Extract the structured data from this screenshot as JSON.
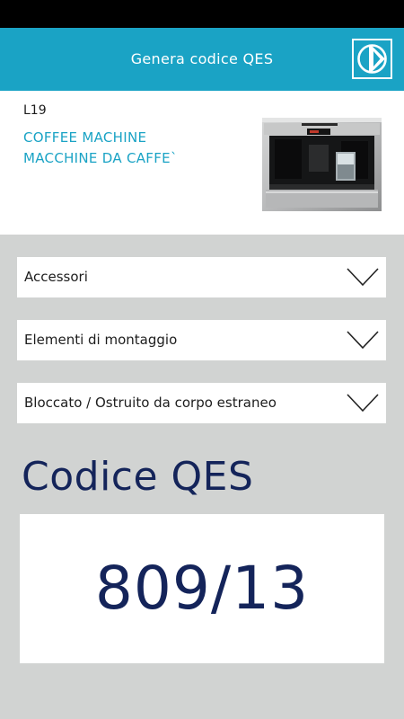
{
  "header": {
    "title": "Genera codice QES",
    "logo_icon": "electrolux-logo-icon",
    "background_color": "#1aa3c5"
  },
  "product": {
    "model": "L19",
    "type_line1": "COFFEE MACHINE",
    "type_line2": "MACCHINE DA CAFFE`",
    "image_icon": "coffee-machine-image"
  },
  "dropdowns": [
    {
      "label": "Accessori",
      "icon": "chevron-down-icon"
    },
    {
      "label": "Elementi di montaggio",
      "icon": "chevron-down-icon"
    },
    {
      "label": "Bloccato / Ostruito da corpo estraneo",
      "icon": "chevron-down-icon"
    }
  ],
  "result": {
    "heading": "Codice QES",
    "value": "809/13",
    "text_color": "#14245a"
  }
}
